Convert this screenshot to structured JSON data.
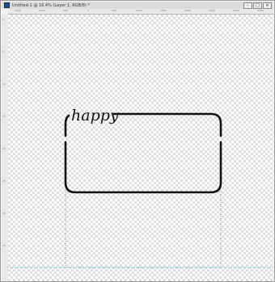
{
  "window": {
    "title": "Untitled-1 @ 16.4% (Layer 1, RGB/8) *",
    "minimize_glyph": "–",
    "maximize_glyph": "□",
    "close_glyph": "×"
  },
  "ruler_top": [
    "1500",
    "1000",
    "500",
    "0",
    "500",
    "1000",
    "1500",
    "2000",
    "2500",
    "3000",
    "3500"
  ],
  "ruler_left": [
    "0",
    "5",
    "10",
    "15",
    "20",
    "25",
    "30",
    "35"
  ],
  "artwork": {
    "script_text": "happy",
    "stroke_color": "#111111",
    "guide_color": "#5fc3d6"
  }
}
